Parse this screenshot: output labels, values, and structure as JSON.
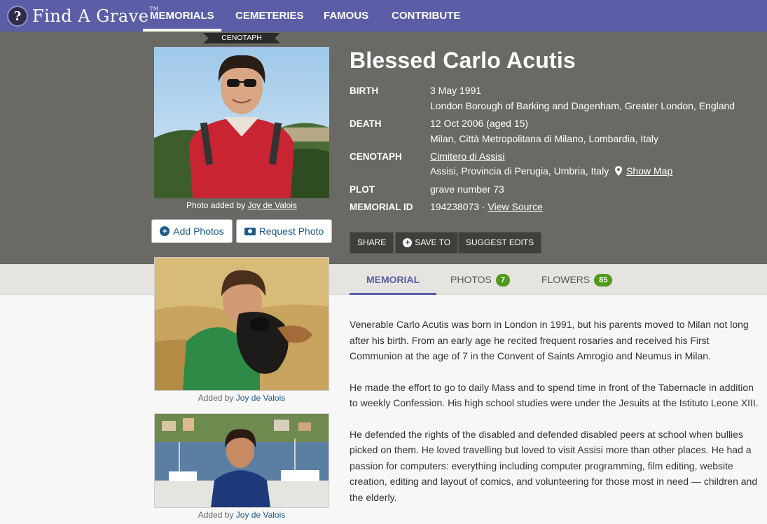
{
  "nav": {
    "logo_text": "Find A Grave",
    "logo_mark": "?",
    "items": [
      "MEMORIALS",
      "CEMETERIES",
      "FAMOUS",
      "CONTRIBUTE"
    ],
    "active": "MEMORIALS"
  },
  "memorial": {
    "ribbon": "CENOTAPH",
    "name": "Blessed Carlo Acutis",
    "photo_caption_prefix": "Photo added by ",
    "photo_caption_user": "Joy de Valois",
    "add_photos_label": "Add Photos",
    "request_photo_label": "Request Photo",
    "facts": {
      "birth_label": "BIRTH",
      "birth_date": "3 May 1991",
      "birth_place": "London Borough of Barking and Dagenham, Greater London, England",
      "death_label": "DEATH",
      "death_date": "12 Oct 2006 (aged 15)",
      "death_place": "Milan, Città Metropolitana di Milano, Lombardia, Italy",
      "cenotaph_label": "CENOTAPH",
      "cenotaph_cemetery": "Cimitero di Assisi",
      "cenotaph_place": "Assisi, Provincia di Perugia, Umbria, Italy",
      "show_map": "Show Map",
      "plot_label": "PLOT",
      "plot_value": "grave number 73",
      "memorial_id_label": "MEMORIAL ID",
      "memorial_id_value": "194238073 · ",
      "view_source": "View Source"
    },
    "actions": {
      "share": "SHARE",
      "save_to": "SAVE TO",
      "suggest_edits": "SUGGEST EDITS"
    }
  },
  "tabs": {
    "memorial": "MEMORIAL",
    "photos": "PHOTOS",
    "photos_count": "7",
    "flowers": "FLOWERS",
    "flowers_count": "85"
  },
  "gallery": {
    "caption_prefix": "Added by ",
    "items": [
      {
        "user": "Joy de Valois"
      },
      {
        "user": "Joy de Valois"
      }
    ]
  },
  "bio": [
    "Venerable Carlo Acutis was born in London in 1991, but his parents moved to Milan not long after his birth. From an early age he recited frequent rosaries and received his First Communion at the age of 7 in the Convent of Saints Amrogio and Neumus in Milan.",
    "He made the effort to go to daily Mass and to spend time in front of the Tabernacle in addition to weekly Confession. His high school studies were under the Jesuits at the Istituto Leone XIII.",
    "He defended the rights of the disabled and defended disabled peers at school when bullies picked on them. He loved travelling but loved to visit Assisi more than other places. He had a passion for computers: everything including computer programming, film editing, website creation, editing and layout of comics, and volunteering for those most in need — children and the elderly."
  ],
  "colors": {
    "nav": "#5b5ea6",
    "hero": "#6a6a64",
    "link": "#1c5a8a",
    "badge": "#4e9a1a"
  }
}
